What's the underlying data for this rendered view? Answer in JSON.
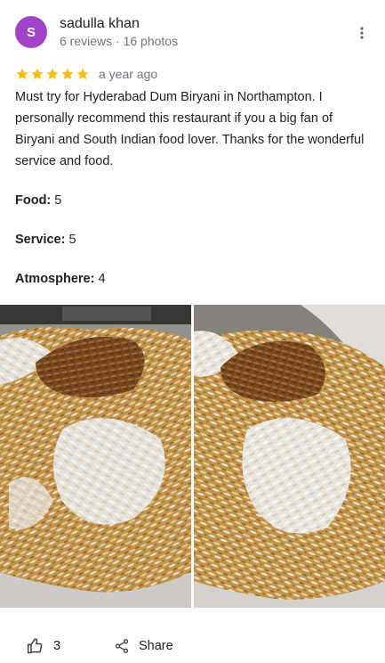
{
  "reviewer": {
    "initial": "S",
    "name": "sadulla khan",
    "meta": "6 reviews · 16 photos",
    "avatar_color": "#a142c8"
  },
  "rating": {
    "stars": 5,
    "max_stars": 5,
    "star_color": "#fbbc04",
    "time": "a year ago"
  },
  "review_text": "Must try for Hyderabad Dum Biryani in Northampton. I personally recommend this restaurant if you a big fan of Biryani and South Indian food lover. Thanks for the wonderful service and food.",
  "attributes": [
    {
      "label": "Food:",
      "value": "5"
    },
    {
      "label": "Service:",
      "value": "5"
    },
    {
      "label": "Atmosphere:",
      "value": "4"
    }
  ],
  "photos": [
    {
      "icon": "biryani-photo"
    },
    {
      "icon": "biryani-photo"
    }
  ],
  "actions": {
    "like_count": "3",
    "like_icon": "thumbs-up-icon",
    "share_label": "Share",
    "share_icon": "share-icon",
    "more_icon": "more-vertical-icon"
  }
}
